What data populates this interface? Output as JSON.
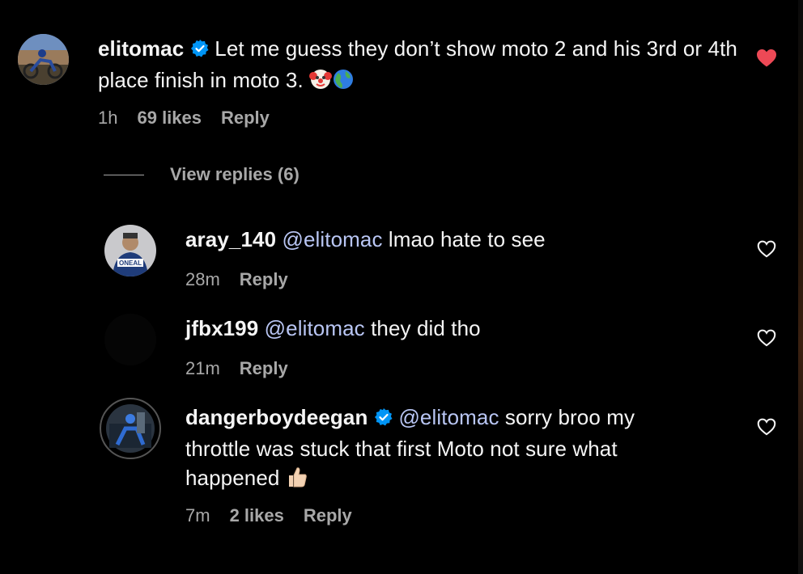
{
  "comments": [
    {
      "username": "elitomac",
      "verified": true,
      "mention": "",
      "text": "Let me guess they don’t show moto 2 and his 3rd or 4th place finish in moto 3.",
      "emojis": [
        "clown-face-emoji",
        "globe-emoji"
      ],
      "time": "1h",
      "likes": "69 likes",
      "reply": "Reply",
      "liked": true,
      "heart_color": "#ed4956"
    }
  ],
  "view_replies": "View replies (6)",
  "replies": [
    {
      "username": "aray_140",
      "verified": false,
      "mention": "@elitomac",
      "text": "lmao hate to see",
      "time": "28m",
      "likes": "",
      "reply": "Reply",
      "liked": false
    },
    {
      "username": "jfbx199",
      "verified": false,
      "mention": "@elitomac",
      "text": "they did tho",
      "time": "21m",
      "likes": "",
      "reply": "Reply",
      "liked": false
    },
    {
      "username": "dangerboydeegan",
      "verified": true,
      "mention": "@elitomac",
      "text_line1": "sorry broo my",
      "text_line2": "throttle was stuck that first Moto not sure what",
      "text_line3": "happened",
      "emojis": [
        "thumbs-up-emoji"
      ],
      "time": "7m",
      "likes": "2 likes",
      "reply": "Reply",
      "liked": false
    }
  ],
  "colors": {
    "background": "#000000",
    "text": "#f5f5f5",
    "secondary": "#a8a8a8",
    "mention": "#b9c6f4",
    "verified": "#0095f6",
    "liked_heart": "#ed4956"
  },
  "icons": {
    "verified": "verified-badge-icon",
    "heart_filled": "heart-filled-icon",
    "heart_outline": "heart-outline-icon"
  }
}
